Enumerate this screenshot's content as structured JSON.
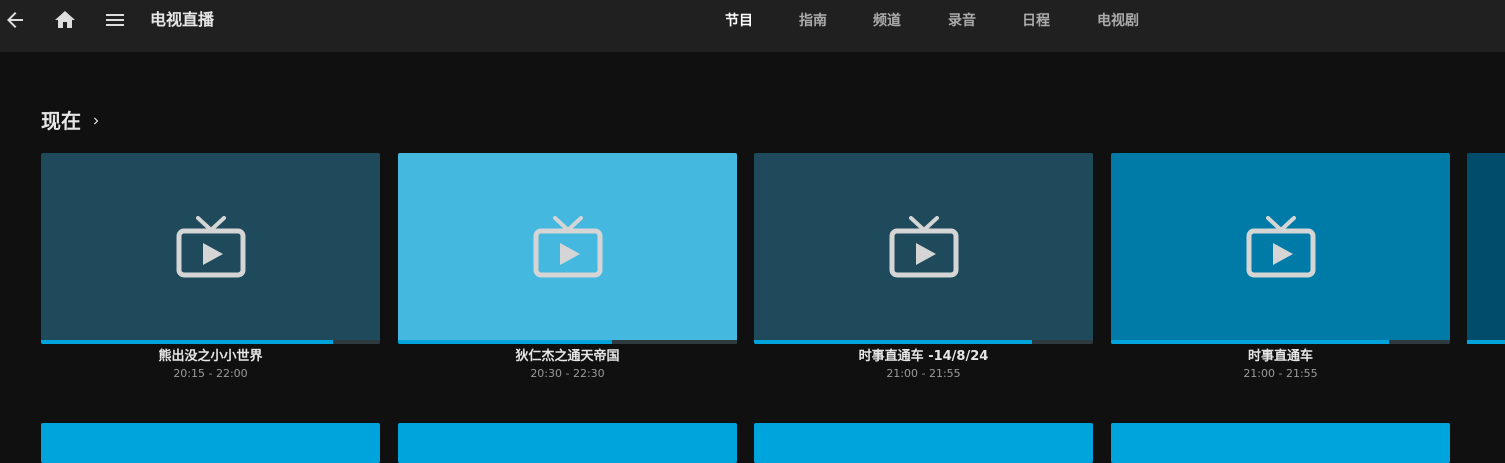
{
  "app": {
    "title": "电视直播"
  },
  "nav": {
    "back_icon": "arrow-left-icon",
    "home_icon": "home-icon",
    "menu_icon": "hamburger-menu-icon"
  },
  "tabs": [
    {
      "label": "节目",
      "active": true
    },
    {
      "label": "指南",
      "active": false
    },
    {
      "label": "频道",
      "active": false
    },
    {
      "label": "录音",
      "active": false
    },
    {
      "label": "日程",
      "active": false
    },
    {
      "label": "电视剧",
      "active": false
    }
  ],
  "section": {
    "title": "现在",
    "icon": "chevron-right-icon"
  },
  "programs": [
    {
      "name": "熊出没之小小世界",
      "time": "20:15 - 22:00",
      "color": "#1e4a5c",
      "progress": 0.86
    },
    {
      "name": "狄仁杰之通天帝国",
      "time": "20:30 - 22:30",
      "color": "#45b8e0",
      "progress": 0.63
    },
    {
      "name": "时事直通车 -14/8/24",
      "time": "21:00 - 21:55",
      "color": "#1e4a5c",
      "progress": 0.82
    },
    {
      "name": "时事直通车",
      "time": "21:00 - 21:55",
      "color": "#007ba8",
      "progress": 0.82
    }
  ],
  "colors": {
    "accent": "#00a4dc",
    "background": "#101010",
    "header": "#202020",
    "peek_card": "#004d6b"
  },
  "thumbnail_icon": "tv-play-icon"
}
